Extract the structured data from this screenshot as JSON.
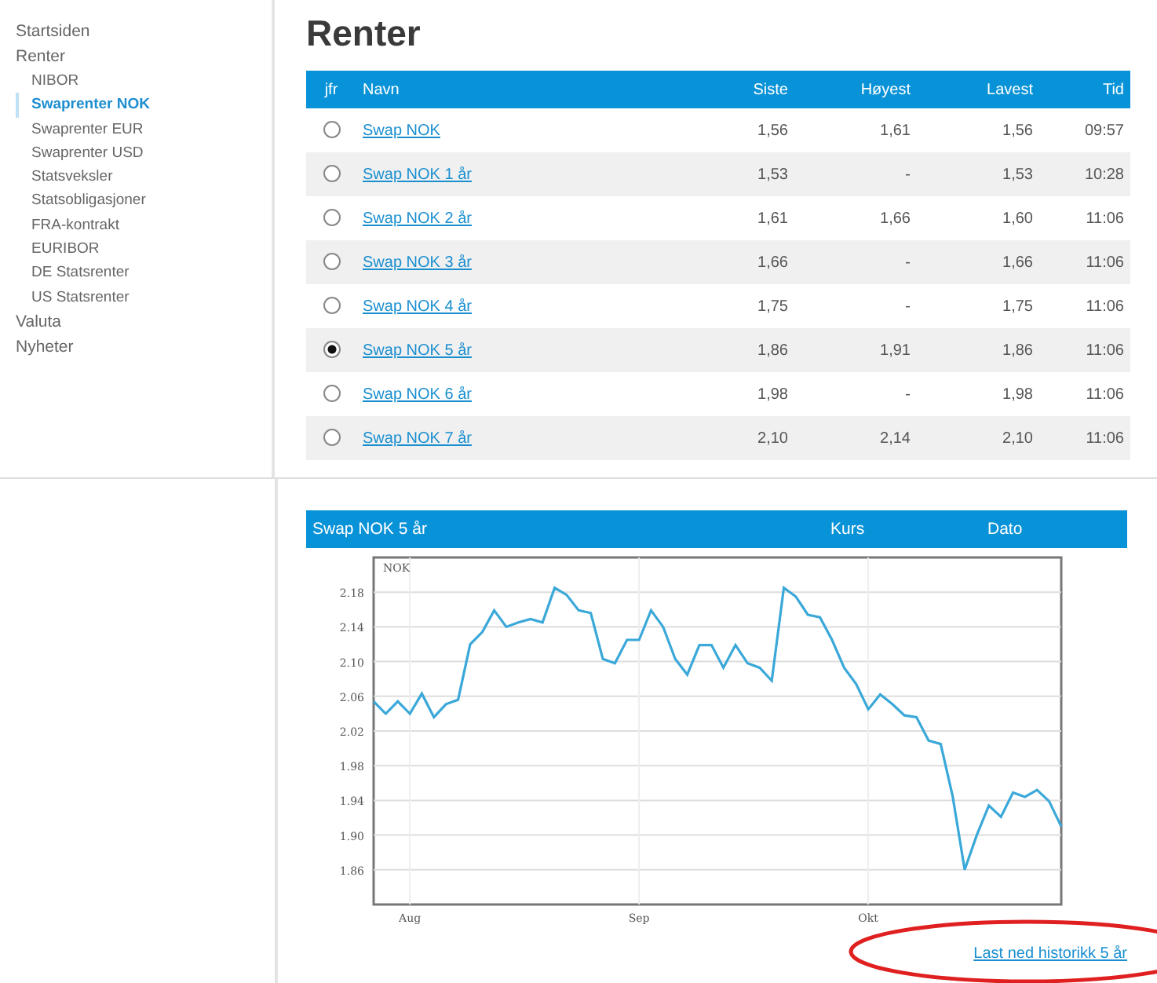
{
  "nav": [
    {
      "label": "Startsiden",
      "selected": false
    },
    {
      "label": "Renter",
      "selected": false,
      "children": [
        {
          "label": "NIBOR",
          "selected": false
        },
        {
          "label": "Swaprenter NOK",
          "selected": true
        },
        {
          "label": "Swaprenter EUR",
          "selected": false
        },
        {
          "label": "Swaprenter USD",
          "selected": false
        },
        {
          "label": "Statsveksler",
          "selected": false
        },
        {
          "label": "Statsobligasjoner",
          "selected": false
        },
        {
          "label": "FRA-kontrakt",
          "selected": false
        },
        {
          "label": "EURIBOR",
          "selected": false
        },
        {
          "label": "DE Statsrenter",
          "selected": false
        },
        {
          "label": "US Statsrenter",
          "selected": false
        }
      ]
    },
    {
      "label": "Valuta",
      "selected": false
    },
    {
      "label": "Nyheter",
      "selected": false
    }
  ],
  "heading": "Renter",
  "table": {
    "columns": [
      "jfr",
      "Navn",
      "Siste",
      "Høyest",
      "Lavest",
      "Tid"
    ],
    "rows": [
      {
        "selected": false,
        "name": "Swap NOK",
        "siste": "1,56",
        "hoyest": "1,61",
        "lavest": "1,56",
        "tid": "09:57"
      },
      {
        "selected": false,
        "name": "Swap NOK 1 år",
        "siste": "1,53",
        "hoyest": "-",
        "lavest": "1,53",
        "tid": "10:28"
      },
      {
        "selected": false,
        "name": "Swap NOK 2 år",
        "siste": "1,61",
        "hoyest": "1,66",
        "lavest": "1,60",
        "tid": "11:06"
      },
      {
        "selected": false,
        "name": "Swap NOK 3 år",
        "siste": "1,66",
        "hoyest": "-",
        "lavest": "1,66",
        "tid": "11:06"
      },
      {
        "selected": false,
        "name": "Swap NOK 4 år",
        "siste": "1,75",
        "hoyest": "-",
        "lavest": "1,75",
        "tid": "11:06"
      },
      {
        "selected": true,
        "name": "Swap NOK 5 år",
        "siste": "1,86",
        "hoyest": "1,91",
        "lavest": "1,86",
        "tid": "11:06"
      },
      {
        "selected": false,
        "name": "Swap NOK 6 år",
        "siste": "1,98",
        "hoyest": "-",
        "lavest": "1,98",
        "tid": "11:06"
      },
      {
        "selected": false,
        "name": "Swap NOK 7 år",
        "siste": "2,10",
        "hoyest": "2,14",
        "lavest": "2,10",
        "tid": "11:06"
      }
    ]
  },
  "chart_panel": {
    "title": "Swap NOK 5 år",
    "kurs_label": "Kurs",
    "dato_label": "Dato",
    "chart_data": {
      "type": "line",
      "ylabel": "NOK",
      "categories": [
        null,
        null,
        null,
        "Aug",
        null,
        null,
        null,
        null,
        null,
        null,
        null,
        null,
        null,
        null,
        null,
        null,
        null,
        null,
        null,
        null,
        null,
        null,
        "Sep",
        null,
        null,
        null,
        null,
        null,
        null,
        null,
        null,
        null,
        null,
        null,
        null,
        null,
        null,
        null,
        null,
        null,
        null,
        "Okt",
        null,
        null,
        null,
        null,
        null,
        null,
        null,
        null,
        null,
        null,
        null,
        null,
        null,
        null,
        null,
        null
      ],
      "series": [
        {
          "color": "#3aa8d8",
          "values": [
            2.054,
            2.04,
            2.054,
            2.04,
            2.063,
            2.036,
            2.051,
            2.056,
            2.12,
            2.134,
            2.159,
            2.14,
            2.145,
            2.149,
            2.145,
            2.185,
            2.177,
            2.159,
            2.156,
            2.103,
            2.098,
            2.125,
            2.125,
            2.159,
            2.14,
            2.103,
            2.085,
            2.119,
            2.119,
            2.093,
            2.119,
            2.098,
            2.093,
            2.078,
            2.185,
            2.175,
            2.154,
            2.151,
            2.125,
            2.093,
            2.074,
            2.045,
            2.062,
            2.051,
            2.038,
            2.036,
            2.009,
            2.005,
            1.945,
            1.86,
            1.9,
            1.934,
            1.921,
            1.949,
            1.944,
            1.952,
            1.939,
            1.91
          ]
        }
      ],
      "grid": true,
      "ylim": [
        1.82,
        2.22
      ],
      "yticks": [
        {
          "value": 2.18,
          "label": "2.18"
        },
        {
          "value": 2.14,
          "label": "2.14"
        },
        {
          "value": 2.1,
          "label": "2.10"
        },
        {
          "value": 2.06,
          "label": "2.06"
        },
        {
          "value": 2.02,
          "label": "2.02"
        },
        {
          "value": 1.98,
          "label": "1.98"
        },
        {
          "value": 1.94,
          "label": "1.94"
        },
        {
          "value": 1.9,
          "label": "1.90"
        },
        {
          "value": 1.86,
          "label": "1.86"
        }
      ]
    }
  },
  "download_link": {
    "label": "Last ned historikk 5 år",
    "highlighted": true
  }
}
